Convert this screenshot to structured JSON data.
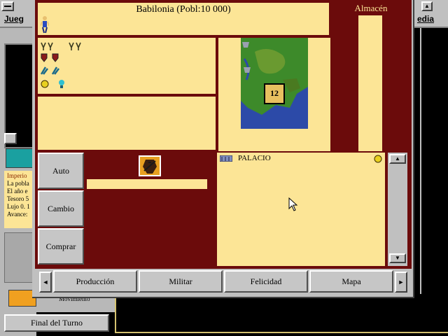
{
  "menubar": {
    "left_label": "Jueg",
    "right_label": "edia"
  },
  "background": {
    "info_lines": [
      "Imperio",
      "La pobla",
      "El año e",
      "Tesoro 5",
      "Lujo 0. 1",
      "Avance:"
    ],
    "status_text": "Movimiento",
    "end_turn_label": "Final del Turno"
  },
  "city": {
    "title": "Babilonia (Pobl:10 000)",
    "storage_label": "Almacén",
    "tile_label": "12",
    "left_buttons": [
      "Auto",
      "Cambio",
      "Comprar"
    ],
    "improvements": [
      {
        "name": "PALACIO",
        "icon": "palace-icon"
      }
    ],
    "tabs": [
      "Producción",
      "Militar",
      "Felicidad",
      "Mapa"
    ],
    "resource_rows": [
      {
        "icons": [
          "food-icon",
          "food-icon",
          "food-icon",
          "food-icon"
        ]
      },
      {
        "icons": [
          "shield-icon",
          "shield-icon"
        ]
      },
      {
        "icons": [
          "trade-icon",
          "trade-icon"
        ]
      },
      {
        "icons": [
          "coin-icon",
          "lightbulb-icon"
        ]
      }
    ],
    "colors": {
      "panel": "#fce596",
      "frame": "#6b0b0b",
      "water": "#2c4aa8",
      "grass": "#3d8a2a"
    }
  }
}
